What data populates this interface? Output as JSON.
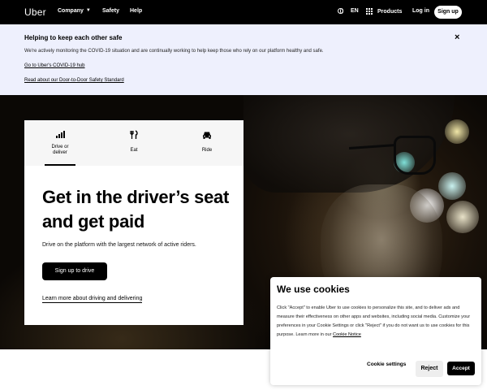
{
  "nav": {
    "logo": "Uber",
    "company": "Company",
    "safety": "Safety",
    "help": "Help",
    "language": "EN",
    "products": "Products",
    "login": "Log in",
    "signup": "Sign up"
  },
  "banner": {
    "title": "Helping to keep each other safe",
    "text": "We're actively monitoring the COVID-19 situation and are continually working to help keep those who rely on our platform healthy and safe.",
    "link_covid": "Go to Uber's COVID-19 hub",
    "link_safety": "Read about our Door-to-Door Safety Standard",
    "close": "×"
  },
  "card": {
    "tabs": [
      {
        "label": "Drive or deliver",
        "icon": "bar-signal-icon",
        "selected": true
      },
      {
        "label": "Eat",
        "icon": "fork-knife-icon",
        "selected": false
      },
      {
        "label": "Ride",
        "icon": "car-icon",
        "selected": false
      }
    ],
    "title": "Get in the driver’s seat and get paid",
    "subtitle": "Drive on the platform with the largest network of active riders.",
    "cta": "Sign up to drive",
    "link": "Learn more about driving and delivering"
  },
  "cookie": {
    "title": "We use cookies",
    "body": "Click \"Accept\" to enable Uber to use cookies to personalize this site, and to deliver ads and measure their effectiveness on other apps and websites, including social media. Customize your preferences in your Cookie Settings or click \"Reject\" if you do not want us to use cookies for this purpose. Learn more in our ",
    "notice_link": "Cookie Notice",
    "settings": "Cookie settings",
    "reject": "Reject",
    "accept": "Accept"
  },
  "colors": {
    "nav_bg": "#000000",
    "banner_bg": "#eef0fd",
    "tabs_bg": "#f6f6f6",
    "accent": "#000000"
  }
}
